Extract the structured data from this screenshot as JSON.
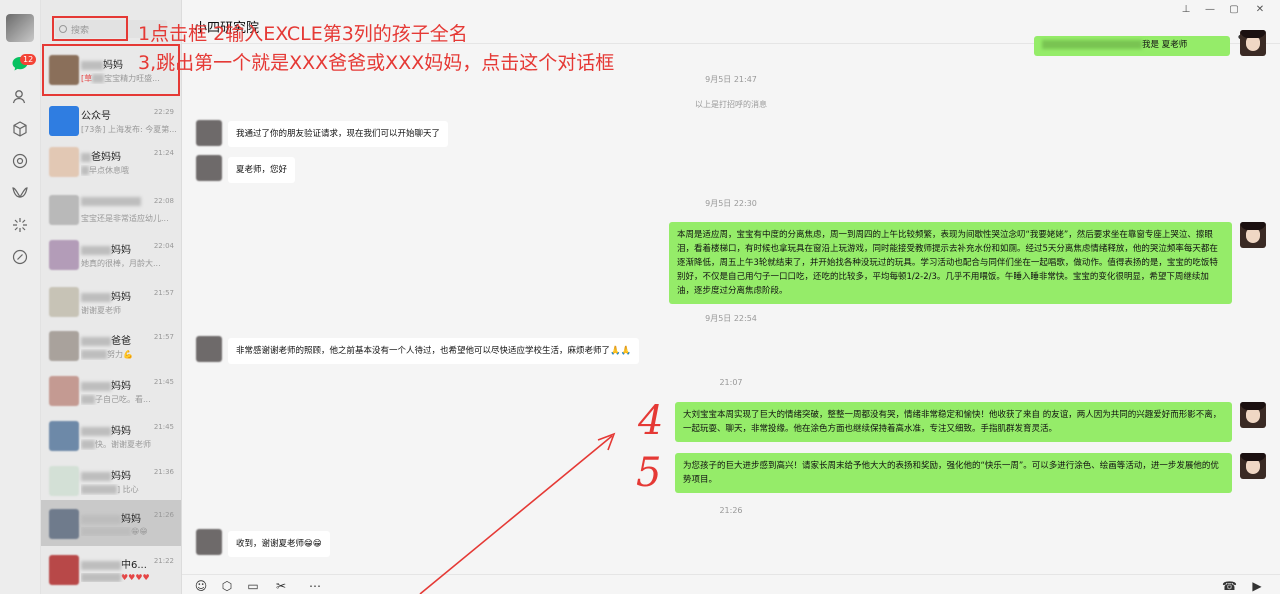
{
  "rail": {
    "badge": "12",
    "icons": [
      "chat-icon",
      "contacts-icon",
      "cube-icon",
      "moments-icon",
      "channels-icon",
      "sparkle-icon",
      "link-icon"
    ]
  },
  "search": {
    "placeholder": "搜索"
  },
  "window": {
    "title": "小四研究院"
  },
  "chat_list": [
    {
      "name": "妈妈",
      "time": "",
      "preview_tag": "[草",
      "preview": "宝宝精力旺盛..."
    },
    {
      "name": "公众号",
      "time": "22:29",
      "preview": "[73条] 上海发布: 今夏第..."
    },
    {
      "name": "爸妈妈",
      "time": "21:24",
      "preview": "早点休息哦"
    },
    {
      "name": "",
      "time": "22:08",
      "preview": "宝宝还是非常适应幼儿..."
    },
    {
      "name": "妈妈",
      "time": "22:04",
      "preview": "她真的很棒，月龄大..."
    },
    {
      "name": "妈妈",
      "time": "21:57",
      "preview": "谢谢夏老师"
    },
    {
      "name": "爸爸",
      "time": "21:57",
      "preview": "努力💪"
    },
    {
      "name": "妈妈",
      "time": "21:45",
      "preview": "子自己吃。看..."
    },
    {
      "name": "妈妈",
      "time": "21:45",
      "preview": "快。谢谢夏老师"
    },
    {
      "name": "妈妈",
      "time": "21:36",
      "preview": "] 比心"
    },
    {
      "name": "妈妈",
      "time": "21:26",
      "preview": "😁😁"
    },
    {
      "name": "中6...",
      "time": "21:22",
      "preview": "♥♥♥♥"
    }
  ],
  "messages": {
    "top_partial": "我是 夏老师",
    "ts1": "9月5日 21:47",
    "system": "以上是打招呼的消息",
    "in1": "我通过了你的朋友验证请求，现在我们可以开始聊天了",
    "in2": "夏老师，您好",
    "ts2": "9月5日 22:30",
    "out1": "本周是适应周，宝宝有中度的分离焦虑，周一到周四的上午比较频繁，表现为间歇性哭泣念叨“我要姥姥”，然后要求坐在靠窗专座上哭泣、擦眼泪，看着楼梯口，有时候也拿玩具在窗沿上玩游戏，同时能接受教师提示去补充水份和如厕。经过5天分离焦虑情绪释放，他的哭泣频率每天都在逐渐降低，周五上午3轮就结束了，并开始找各种没玩过的玩具。学习活动也配合与同伴们坐在一起唱歌，做动作。值得表扬的是，宝宝的吃饭特别好，不仅是自己用勺子一口口吃，还吃的比较多，平均每顿1/2-2/3。几乎不用喂饭。午睡入睡非常快。宝宝的变化很明显，希望下周继续加油，逐步度过分离焦虑阶段。",
    "ts3": "9月5日 22:54",
    "in3": "非常感谢谢老师的照顾，他之前基本没有一个人待过，也希望他可以尽快适应学校生活，麻烦老师了🙏🙏",
    "ts4": "21:07",
    "out2": "大刘宝宝本周实现了巨大的情绪突破，整整一周都没有哭，情绪非常稳定和愉快！他收获了来自        的友谊，两人因为共同的兴趣爱好而形影不离，一起玩耍、聊天，非常投缘。他在涂色方面也继续保持着高水准，专注又细致。手指肌群发育灵活。",
    "out3": "为您孩子的巨大进步感到高兴！请家长周末给予他大大的表扬和奖励，强化他的“快乐一周”。可以多进行涂色、绘画等活动，进一步发展他的优势项目。",
    "ts5": "21:26",
    "in4": "收到，谢谢夏老师😁😁"
  },
  "annotations": {
    "step1": "1点击框 2输入EXCLE第3列的孩子全名",
    "step3": "3,跳出第一个就是XXX爸爸或XXX妈妈，点击这个对话框",
    "num4": "4",
    "num5": "5"
  },
  "colors": {
    "annotation": "#e53935",
    "bubble_out": "#95ec69",
    "bubble_in": "#ffffff",
    "chat_green": "#07c160"
  }
}
